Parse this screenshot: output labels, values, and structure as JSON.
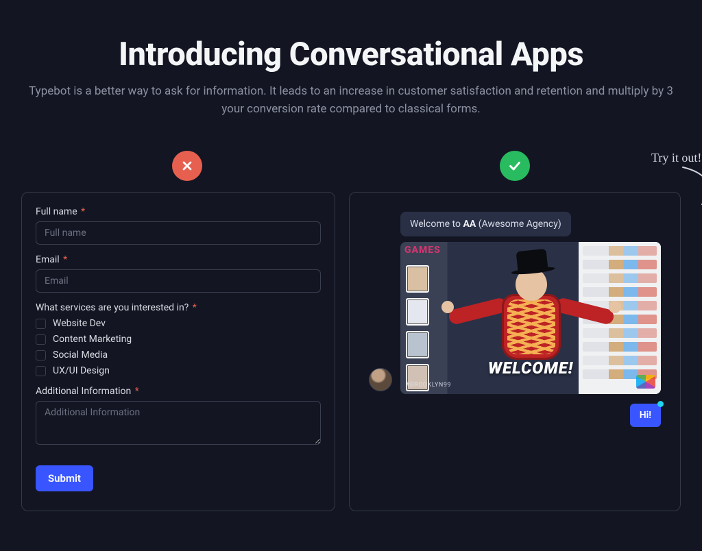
{
  "hero": {
    "title": "Introducing Conversational Apps",
    "subtitle": "Typebot is a better way to ask for information. It leads to an increase in customer satisfaction and retention and multiply by 3 your conversion rate compared to classical forms."
  },
  "try_it_label": "Try it out!",
  "form": {
    "full_name": {
      "label": "Full name",
      "placeholder": "Full name",
      "required": true
    },
    "email": {
      "label": "Email",
      "placeholder": "Email",
      "required": true
    },
    "services": {
      "label": "What services are you interested in?",
      "required": true,
      "options": [
        "Website Dev",
        "Content Marketing",
        "Social Media",
        "UX/UI Design"
      ]
    },
    "additional": {
      "label": "Additional Information",
      "placeholder": "Additional Information",
      "required": true
    },
    "submit_label": "Submit"
  },
  "chat": {
    "welcome_prefix": "Welcome to ",
    "welcome_bold": "AA",
    "welcome_suffix": " (Awesome Agency)",
    "media_overlay": "WELCOME!",
    "media_hashtag": "#BROOKLYN99",
    "media_corner_tag": "GAMES",
    "reply_label": "Hi!"
  },
  "colors": {
    "accent": "#3855ff",
    "bad_badge": "#e7604f",
    "good_badge": "#29bb5f"
  }
}
